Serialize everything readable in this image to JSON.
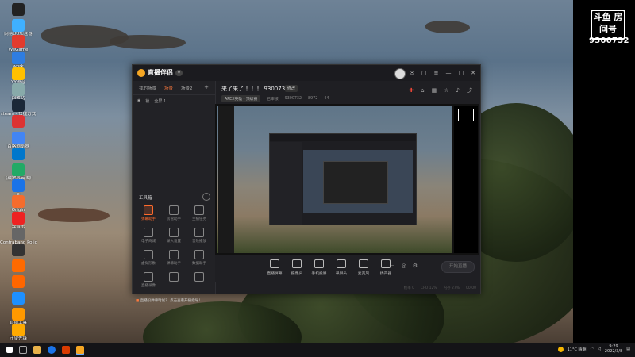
{
  "desktop_icons": [
    {
      "label": "",
      "color": "#222"
    },
    {
      "label": "网易UU加速器",
      "color": "#3fb0ff"
    },
    {
      "label": "WeGame",
      "color": "#e23b2e"
    },
    {
      "label": "work",
      "color": "#2f7de1"
    },
    {
      "label": "YY语音",
      "color": "#ffc000"
    },
    {
      "label": "回收站",
      "color": "#8aa"
    },
    {
      "label": "steam - 快捷方式",
      "color": "#1b2838"
    },
    {
      "label": "",
      "color": "#d33"
    },
    {
      "label": "百格浏览器",
      "color": "#4285f4"
    },
    {
      "label": "",
      "color": "#07c"
    },
    {
      "label": "《战地风云 5》",
      "color": "#2a6"
    },
    {
      "label": "e",
      "color": "#1a73e8"
    },
    {
      "label": "Origin",
      "color": "#f56c2d"
    },
    {
      "label": "云音乐",
      "color": "#e22"
    },
    {
      "label": "Contraband Police Pro...",
      "color": "#666"
    },
    {
      "label": "",
      "color": "#333"
    },
    {
      "label": "",
      "color": "#ff6a00"
    },
    {
      "label": "",
      "color": "#f60"
    },
    {
      "label": "",
      "color": "#1e90ff"
    },
    {
      "label": "直播工具",
      "color": "#f90"
    },
    {
      "label": "守望先锋",
      "color": "#fa0"
    }
  ],
  "room_badge": {
    "logo": "斗鱼 房间号",
    "number": "9300732"
  },
  "app": {
    "brand": "直播伴侣",
    "version": "v",
    "tabs": [
      {
        "label": "我的场景",
        "active": false
      },
      {
        "label": "场景",
        "active": true
      },
      {
        "label": "场景2",
        "active": false
      }
    ],
    "add_tab": "+",
    "scene_tools": [
      "◉",
      "锁",
      "全屏 1"
    ],
    "toolbox_title": "工具箱",
    "toolbox": [
      {
        "label": "弹幕助手",
        "hot": true
      },
      {
        "label": "房管助手",
        "hot": false
      },
      {
        "label": "主播任务",
        "hot": false
      },
      {
        "label": "电子商城",
        "hot": false
      },
      {
        "label": "录入设置",
        "hot": false
      },
      {
        "label": "音效播放",
        "hot": false
      },
      {
        "label": "虚拟形象",
        "hot": false
      },
      {
        "label": "弹幕助手",
        "hot": false
      },
      {
        "label": "数据助手",
        "hot": false
      },
      {
        "label": "直播录像",
        "hot": false
      },
      {
        "label": "",
        "hot": false
      },
      {
        "label": "",
        "hot": false
      }
    ],
    "notice_text": "直播没弹幕时候？",
    "notice_link": "点击查看开播指导！",
    "room_title": "来了来了 ！！！ 9300732",
    "edit_label": "修改",
    "room_meta": {
      "category": "APEX英雄 - 顶级赛",
      "mode": "已审核",
      "room_id": "9300732",
      "hot": "8972",
      "fans": "44"
    },
    "controls": [
      {
        "label": "直播屏幕"
      },
      {
        "label": "摄像头"
      },
      {
        "label": "手机投屏"
      },
      {
        "label": "录屏头"
      },
      {
        "label": "麦克风"
      },
      {
        "label": "扬声器"
      }
    ],
    "go_live": "开始直播",
    "status": [
      "帧率 0",
      "CPU 12%",
      "内存 27%",
      "00:00"
    ]
  },
  "taskbar": {
    "weather": "11°C 晴朗",
    "time": "9:29",
    "date": "2022/3/8"
  }
}
